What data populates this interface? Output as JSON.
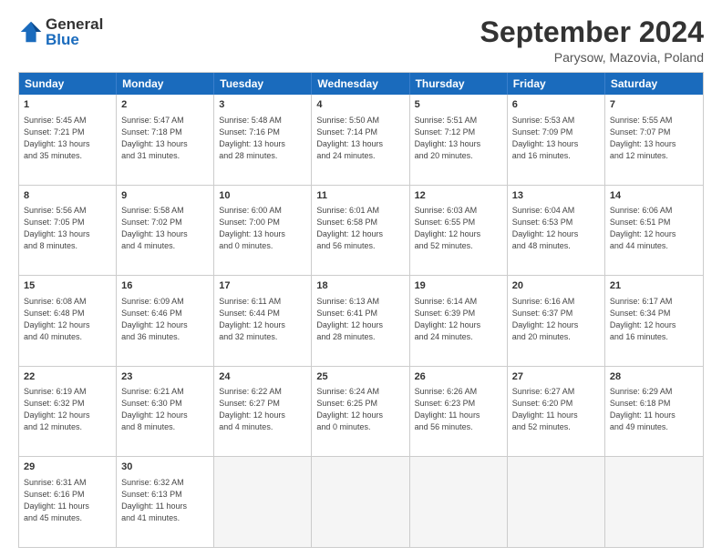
{
  "logo": {
    "general": "General",
    "blue": "Blue"
  },
  "title": "September 2024",
  "location": "Parysow, Mazovia, Poland",
  "header_days": [
    "Sunday",
    "Monday",
    "Tuesday",
    "Wednesday",
    "Thursday",
    "Friday",
    "Saturday"
  ],
  "weeks": [
    [
      {
        "day": "1",
        "lines": [
          "Sunrise: 5:45 AM",
          "Sunset: 7:21 PM",
          "Daylight: 13 hours",
          "and 35 minutes."
        ]
      },
      {
        "day": "2",
        "lines": [
          "Sunrise: 5:47 AM",
          "Sunset: 7:18 PM",
          "Daylight: 13 hours",
          "and 31 minutes."
        ]
      },
      {
        "day": "3",
        "lines": [
          "Sunrise: 5:48 AM",
          "Sunset: 7:16 PM",
          "Daylight: 13 hours",
          "and 28 minutes."
        ]
      },
      {
        "day": "4",
        "lines": [
          "Sunrise: 5:50 AM",
          "Sunset: 7:14 PM",
          "Daylight: 13 hours",
          "and 24 minutes."
        ]
      },
      {
        "day": "5",
        "lines": [
          "Sunrise: 5:51 AM",
          "Sunset: 7:12 PM",
          "Daylight: 13 hours",
          "and 20 minutes."
        ]
      },
      {
        "day": "6",
        "lines": [
          "Sunrise: 5:53 AM",
          "Sunset: 7:09 PM",
          "Daylight: 13 hours",
          "and 16 minutes."
        ]
      },
      {
        "day": "7",
        "lines": [
          "Sunrise: 5:55 AM",
          "Sunset: 7:07 PM",
          "Daylight: 13 hours",
          "and 12 minutes."
        ]
      }
    ],
    [
      {
        "day": "8",
        "lines": [
          "Sunrise: 5:56 AM",
          "Sunset: 7:05 PM",
          "Daylight: 13 hours",
          "and 8 minutes."
        ]
      },
      {
        "day": "9",
        "lines": [
          "Sunrise: 5:58 AM",
          "Sunset: 7:02 PM",
          "Daylight: 13 hours",
          "and 4 minutes."
        ]
      },
      {
        "day": "10",
        "lines": [
          "Sunrise: 6:00 AM",
          "Sunset: 7:00 PM",
          "Daylight: 13 hours",
          "and 0 minutes."
        ]
      },
      {
        "day": "11",
        "lines": [
          "Sunrise: 6:01 AM",
          "Sunset: 6:58 PM",
          "Daylight: 12 hours",
          "and 56 minutes."
        ]
      },
      {
        "day": "12",
        "lines": [
          "Sunrise: 6:03 AM",
          "Sunset: 6:55 PM",
          "Daylight: 12 hours",
          "and 52 minutes."
        ]
      },
      {
        "day": "13",
        "lines": [
          "Sunrise: 6:04 AM",
          "Sunset: 6:53 PM",
          "Daylight: 12 hours",
          "and 48 minutes."
        ]
      },
      {
        "day": "14",
        "lines": [
          "Sunrise: 6:06 AM",
          "Sunset: 6:51 PM",
          "Daylight: 12 hours",
          "and 44 minutes."
        ]
      }
    ],
    [
      {
        "day": "15",
        "lines": [
          "Sunrise: 6:08 AM",
          "Sunset: 6:48 PM",
          "Daylight: 12 hours",
          "and 40 minutes."
        ]
      },
      {
        "day": "16",
        "lines": [
          "Sunrise: 6:09 AM",
          "Sunset: 6:46 PM",
          "Daylight: 12 hours",
          "and 36 minutes."
        ]
      },
      {
        "day": "17",
        "lines": [
          "Sunrise: 6:11 AM",
          "Sunset: 6:44 PM",
          "Daylight: 12 hours",
          "and 32 minutes."
        ]
      },
      {
        "day": "18",
        "lines": [
          "Sunrise: 6:13 AM",
          "Sunset: 6:41 PM",
          "Daylight: 12 hours",
          "and 28 minutes."
        ]
      },
      {
        "day": "19",
        "lines": [
          "Sunrise: 6:14 AM",
          "Sunset: 6:39 PM",
          "Daylight: 12 hours",
          "and 24 minutes."
        ]
      },
      {
        "day": "20",
        "lines": [
          "Sunrise: 6:16 AM",
          "Sunset: 6:37 PM",
          "Daylight: 12 hours",
          "and 20 minutes."
        ]
      },
      {
        "day": "21",
        "lines": [
          "Sunrise: 6:17 AM",
          "Sunset: 6:34 PM",
          "Daylight: 12 hours",
          "and 16 minutes."
        ]
      }
    ],
    [
      {
        "day": "22",
        "lines": [
          "Sunrise: 6:19 AM",
          "Sunset: 6:32 PM",
          "Daylight: 12 hours",
          "and 12 minutes."
        ]
      },
      {
        "day": "23",
        "lines": [
          "Sunrise: 6:21 AM",
          "Sunset: 6:30 PM",
          "Daylight: 12 hours",
          "and 8 minutes."
        ]
      },
      {
        "day": "24",
        "lines": [
          "Sunrise: 6:22 AM",
          "Sunset: 6:27 PM",
          "Daylight: 12 hours",
          "and 4 minutes."
        ]
      },
      {
        "day": "25",
        "lines": [
          "Sunrise: 6:24 AM",
          "Sunset: 6:25 PM",
          "Daylight: 12 hours",
          "and 0 minutes."
        ]
      },
      {
        "day": "26",
        "lines": [
          "Sunrise: 6:26 AM",
          "Sunset: 6:23 PM",
          "Daylight: 11 hours",
          "and 56 minutes."
        ]
      },
      {
        "day": "27",
        "lines": [
          "Sunrise: 6:27 AM",
          "Sunset: 6:20 PM",
          "Daylight: 11 hours",
          "and 52 minutes."
        ]
      },
      {
        "day": "28",
        "lines": [
          "Sunrise: 6:29 AM",
          "Sunset: 6:18 PM",
          "Daylight: 11 hours",
          "and 49 minutes."
        ]
      }
    ],
    [
      {
        "day": "29",
        "lines": [
          "Sunrise: 6:31 AM",
          "Sunset: 6:16 PM",
          "Daylight: 11 hours",
          "and 45 minutes."
        ]
      },
      {
        "day": "30",
        "lines": [
          "Sunrise: 6:32 AM",
          "Sunset: 6:13 PM",
          "Daylight: 11 hours",
          "and 41 minutes."
        ]
      },
      {
        "day": "",
        "lines": [],
        "empty": true
      },
      {
        "day": "",
        "lines": [],
        "empty": true
      },
      {
        "day": "",
        "lines": [],
        "empty": true
      },
      {
        "day": "",
        "lines": [],
        "empty": true
      },
      {
        "day": "",
        "lines": [],
        "empty": true
      }
    ]
  ]
}
